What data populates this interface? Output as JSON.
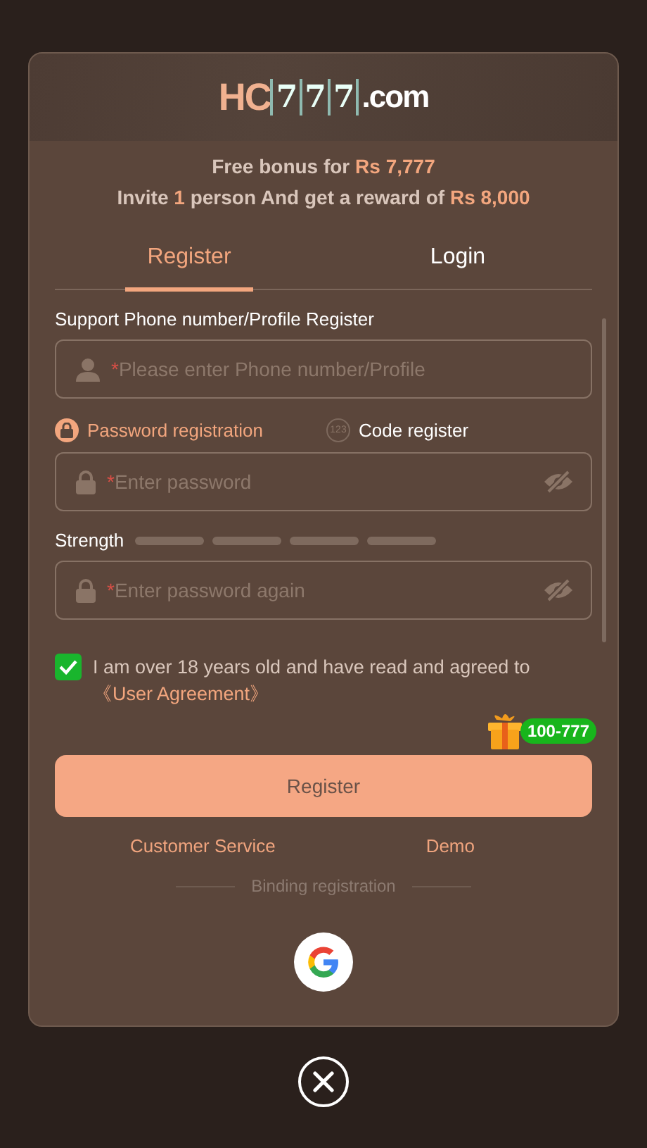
{
  "logo": {
    "prefix": "HC",
    "digits": [
      "7",
      "7",
      "7"
    ],
    "suffix": ".com"
  },
  "bonus": [
    "Free bonus for **Rs 7,777**",
    "Invite **1** person And get a reward of **Rs 8,000**"
  ],
  "tabs": [
    {
      "label": "Register",
      "selected": true
    },
    {
      "label": "Login",
      "selected": false
    }
  ],
  "account_label": "Support Phone number/Profile Register",
  "account_field": {
    "marker": "*",
    "placeholder": "Please enter Phone number/Profile"
  },
  "modes": [
    {
      "label": "Password registration",
      "kind": "lock",
      "selected": true
    },
    {
      "label": "Code register",
      "kind": "digits",
      "badge": "123",
      "selected": false
    }
  ],
  "password_field": {
    "marker": "*",
    "placeholder": "Enter password"
  },
  "strength": {
    "label": "Strength"
  },
  "confirm_field": {
    "marker": "*",
    "placeholder": "Enter password again"
  },
  "agreement": {
    "checked": true,
    "text": "I am over 18 years old and have read and agreed to",
    "link": "《User Agreement》"
  },
  "gift_badge": "100-777",
  "register_button": "Register",
  "links": [
    "Customer Service",
    "Demo"
  ],
  "binding_label": "Binding registration"
}
